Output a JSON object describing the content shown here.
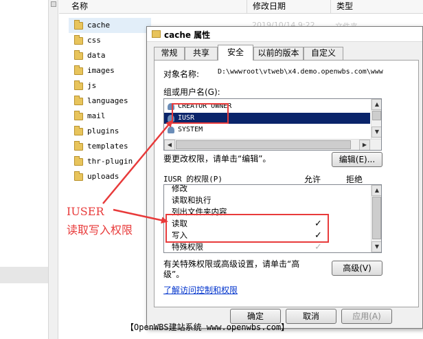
{
  "explorer": {
    "columns": {
      "name": "名称",
      "date": "修改日期",
      "type": "类型"
    },
    "files": [
      "cache",
      "css",
      "data",
      "images",
      "js",
      "languages",
      "mail",
      "plugins",
      "templates",
      "thr-plugin",
      "uploads"
    ],
    "first_row_date": "2019/10/14 9:22",
    "first_row_type": "文件夹"
  },
  "dialog": {
    "title": "cache 属性",
    "tabs": [
      "常规",
      "共享",
      "安全",
      "以前的版本",
      "自定义"
    ],
    "active_tab": "安全",
    "object_label": "对象名称:",
    "object_value": "D:\\wwwroot\\vtweb\\x4.demo.openwbs.com\\www",
    "group_label": "组或用户名(G):",
    "users": [
      "CREATOR OWNER",
      "IUSR",
      "SYSTEM"
    ],
    "selected_user": "IUSR",
    "edit_hint": "要更改权限，请单击“编辑”。",
    "edit_button": "编辑(E)...",
    "perm_title": "IUSR 的权限(P)",
    "perm_allow": "允许",
    "perm_deny": "拒绝",
    "permissions": [
      {
        "name": "修改",
        "allow": ""
      },
      {
        "name": "读取和执行",
        "allow": ""
      },
      {
        "name": "列出文件夹内容",
        "allow": ""
      },
      {
        "name": "读取",
        "allow": "✓"
      },
      {
        "name": "写入",
        "allow": "✓"
      },
      {
        "name": "特殊权限",
        "allow": "✓"
      }
    ],
    "advanced_hint": "有关特殊权限或高级设置，请单击“高级”。",
    "advanced_button": "高级(V)",
    "access_link": "了解访问控制和权限",
    "ok_button": "确定",
    "cancel_button": "取消",
    "apply_button": "应用(A)"
  },
  "annotation": {
    "line1": "IUSER",
    "line2": "读取写入权限",
    "watermark": "【OpenWBS建站系统 www.openwbs.com】",
    "color": "#e83a3a"
  }
}
